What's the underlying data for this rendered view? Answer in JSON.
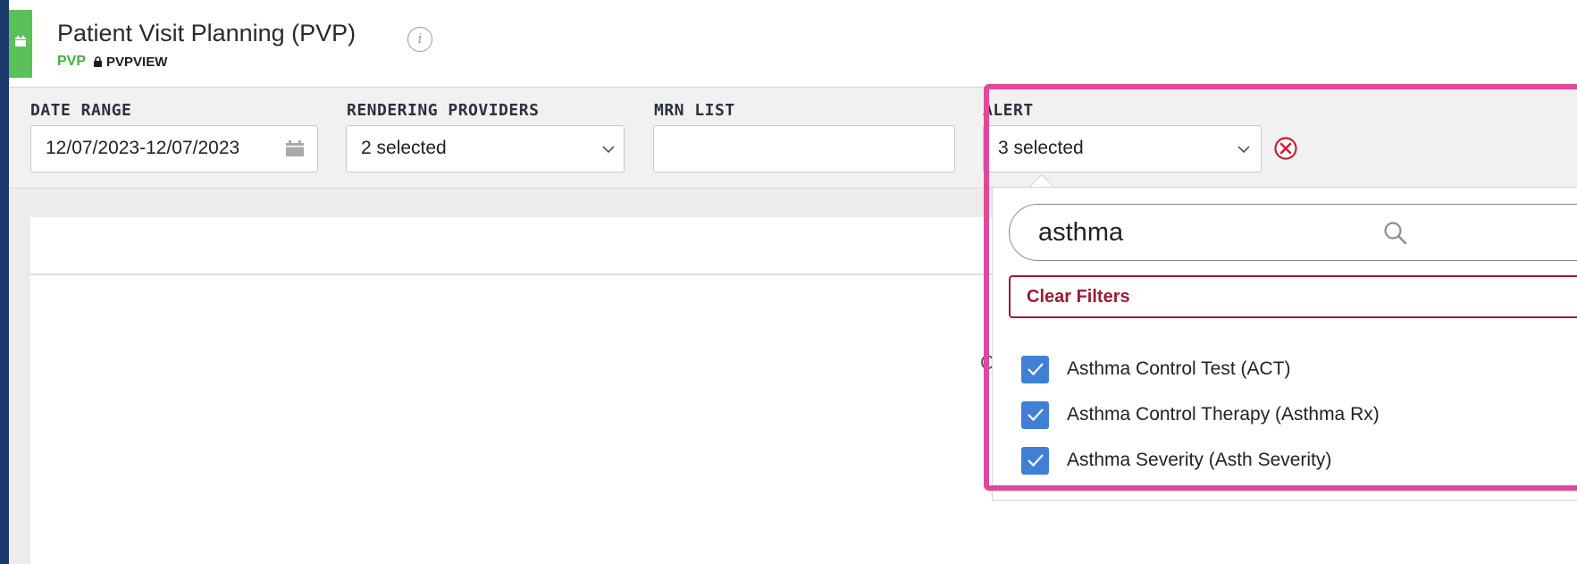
{
  "header": {
    "title": "Patient Visit Planning (PVP)",
    "app_code": "PVP",
    "permission": "PVPVIEW",
    "icons": [
      "calendar-icon",
      "info-icon",
      "lock-icon"
    ]
  },
  "filters": {
    "date_range": {
      "label": "DATE RANGE",
      "value": "12/07/2023-12/07/2023"
    },
    "rendering_providers": {
      "label": "RENDERING PROVIDERS",
      "value": "2 selected"
    },
    "mrn_list": {
      "label": "MRN LIST",
      "value": ""
    },
    "alert": {
      "label": "ALERT",
      "value": "3 selected"
    }
  },
  "alert_dropdown": {
    "search_value": "asthma",
    "clear_label": "Clear Filters",
    "options": [
      {
        "label": "Asthma Control Test (ACT)",
        "checked": true
      },
      {
        "label": "Asthma Control Therapy (Asthma Rx)",
        "checked": true
      },
      {
        "label": "Asthma Severity (Asth Severity)",
        "checked": true
      }
    ]
  },
  "content": {
    "partial_text": "C"
  },
  "colors": {
    "frame": "#1b3a6b",
    "accent_green": "#5cc05a",
    "clear_red": "#9a1b32",
    "checkbox_blue": "#3f7fd6",
    "highlight_pink": "#e0489a"
  }
}
